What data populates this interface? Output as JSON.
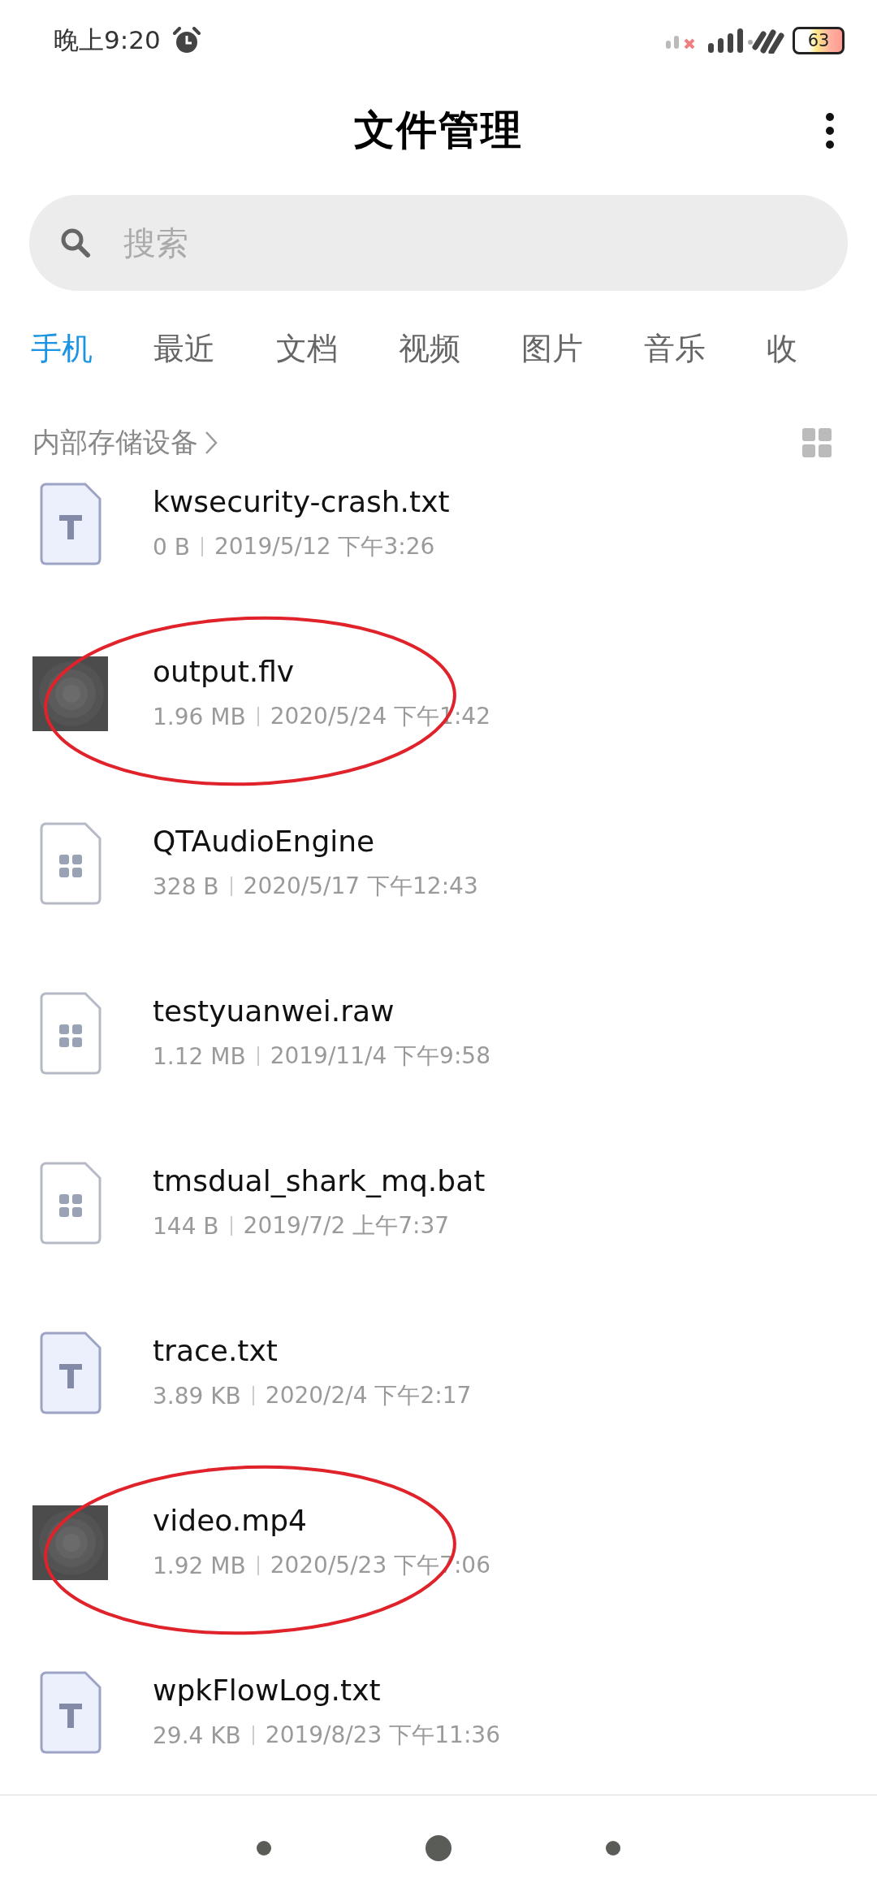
{
  "status_bar": {
    "time": "晚上9:20",
    "battery": "63"
  },
  "header": {
    "title": "文件管理"
  },
  "search": {
    "placeholder": "搜索"
  },
  "tabs": [
    {
      "label": "手机",
      "selected": true
    },
    {
      "label": "最近",
      "selected": false
    },
    {
      "label": "文档",
      "selected": false
    },
    {
      "label": "视频",
      "selected": false
    },
    {
      "label": "图片",
      "selected": false
    },
    {
      "label": "音乐",
      "selected": false
    },
    {
      "label": "收",
      "selected": false
    }
  ],
  "breadcrumb": {
    "path": "内部存储设备"
  },
  "files": [
    {
      "name": "kwsecurity-crash.txt",
      "kind": "text",
      "size": "0 B",
      "date": "2019/5/12 下午3:26",
      "circled": false
    },
    {
      "name": "output.flv",
      "kind": "video",
      "size": "1.96 MB",
      "date": "2020/5/24 下午1:42",
      "circled": true
    },
    {
      "name": "QTAudioEngine",
      "kind": "unknown",
      "size": "328 B",
      "date": "2020/5/17 下午12:43",
      "circled": false
    },
    {
      "name": "testyuanwei.raw",
      "kind": "unknown",
      "size": "1.12 MB",
      "date": "2019/11/4 下午9:58",
      "circled": false
    },
    {
      "name": "tmsdual_shark_mq.bat",
      "kind": "unknown",
      "size": "144 B",
      "date": "2019/7/2 上午7:37",
      "circled": false
    },
    {
      "name": "trace.txt",
      "kind": "text",
      "size": "3.89 KB",
      "date": "2020/2/4 下午2:17",
      "circled": false
    },
    {
      "name": "video.mp4",
      "kind": "video",
      "size": "1.92 MB",
      "date": "2020/5/23 下午7:06",
      "circled": true
    },
    {
      "name": "wpkFlowLog.txt",
      "kind": "text",
      "size": "29.4 KB",
      "date": "2019/8/23 下午11:36",
      "circled": false
    }
  ]
}
